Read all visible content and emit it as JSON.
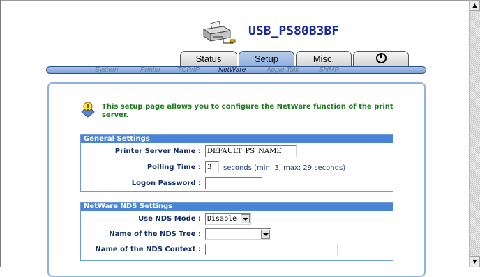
{
  "device": {
    "name": "USB_PS80B3BF"
  },
  "tabs": [
    {
      "label": "Status"
    },
    {
      "label": "Setup"
    },
    {
      "label": "Misc."
    },
    {
      "label": ""
    }
  ],
  "subnav": [
    "System",
    "Printer",
    "TCP/IP",
    "NetWare",
    "Apple Talk",
    "SNMP"
  ],
  "active_subnav": "NetWare",
  "intro": "This setup page allows you to configure the NetWare function of the print server.",
  "general": {
    "title": "General Settings",
    "printer_server_name": {
      "label": "Printer Server Name :",
      "value": "DEFAULT_PS_NAME"
    },
    "polling_time": {
      "label": "Polling Time :",
      "value": "3",
      "hint": "seconds (min: 3, max: 29 seconds)"
    },
    "logon_password": {
      "label": "Logon Password :",
      "value": ""
    }
  },
  "nds": {
    "title": "NetWare NDS Settings",
    "use_nds_mode": {
      "label": "Use NDS Mode :",
      "value": "Disable"
    },
    "nds_tree": {
      "label": "Name of the NDS Tree :",
      "value": ""
    },
    "nds_context": {
      "label": "Name of the NDS Context :",
      "value": ""
    }
  },
  "colors": {
    "accent": "#4a84d8",
    "title": "#1a2aa0",
    "intro": "#1d7a1d"
  }
}
